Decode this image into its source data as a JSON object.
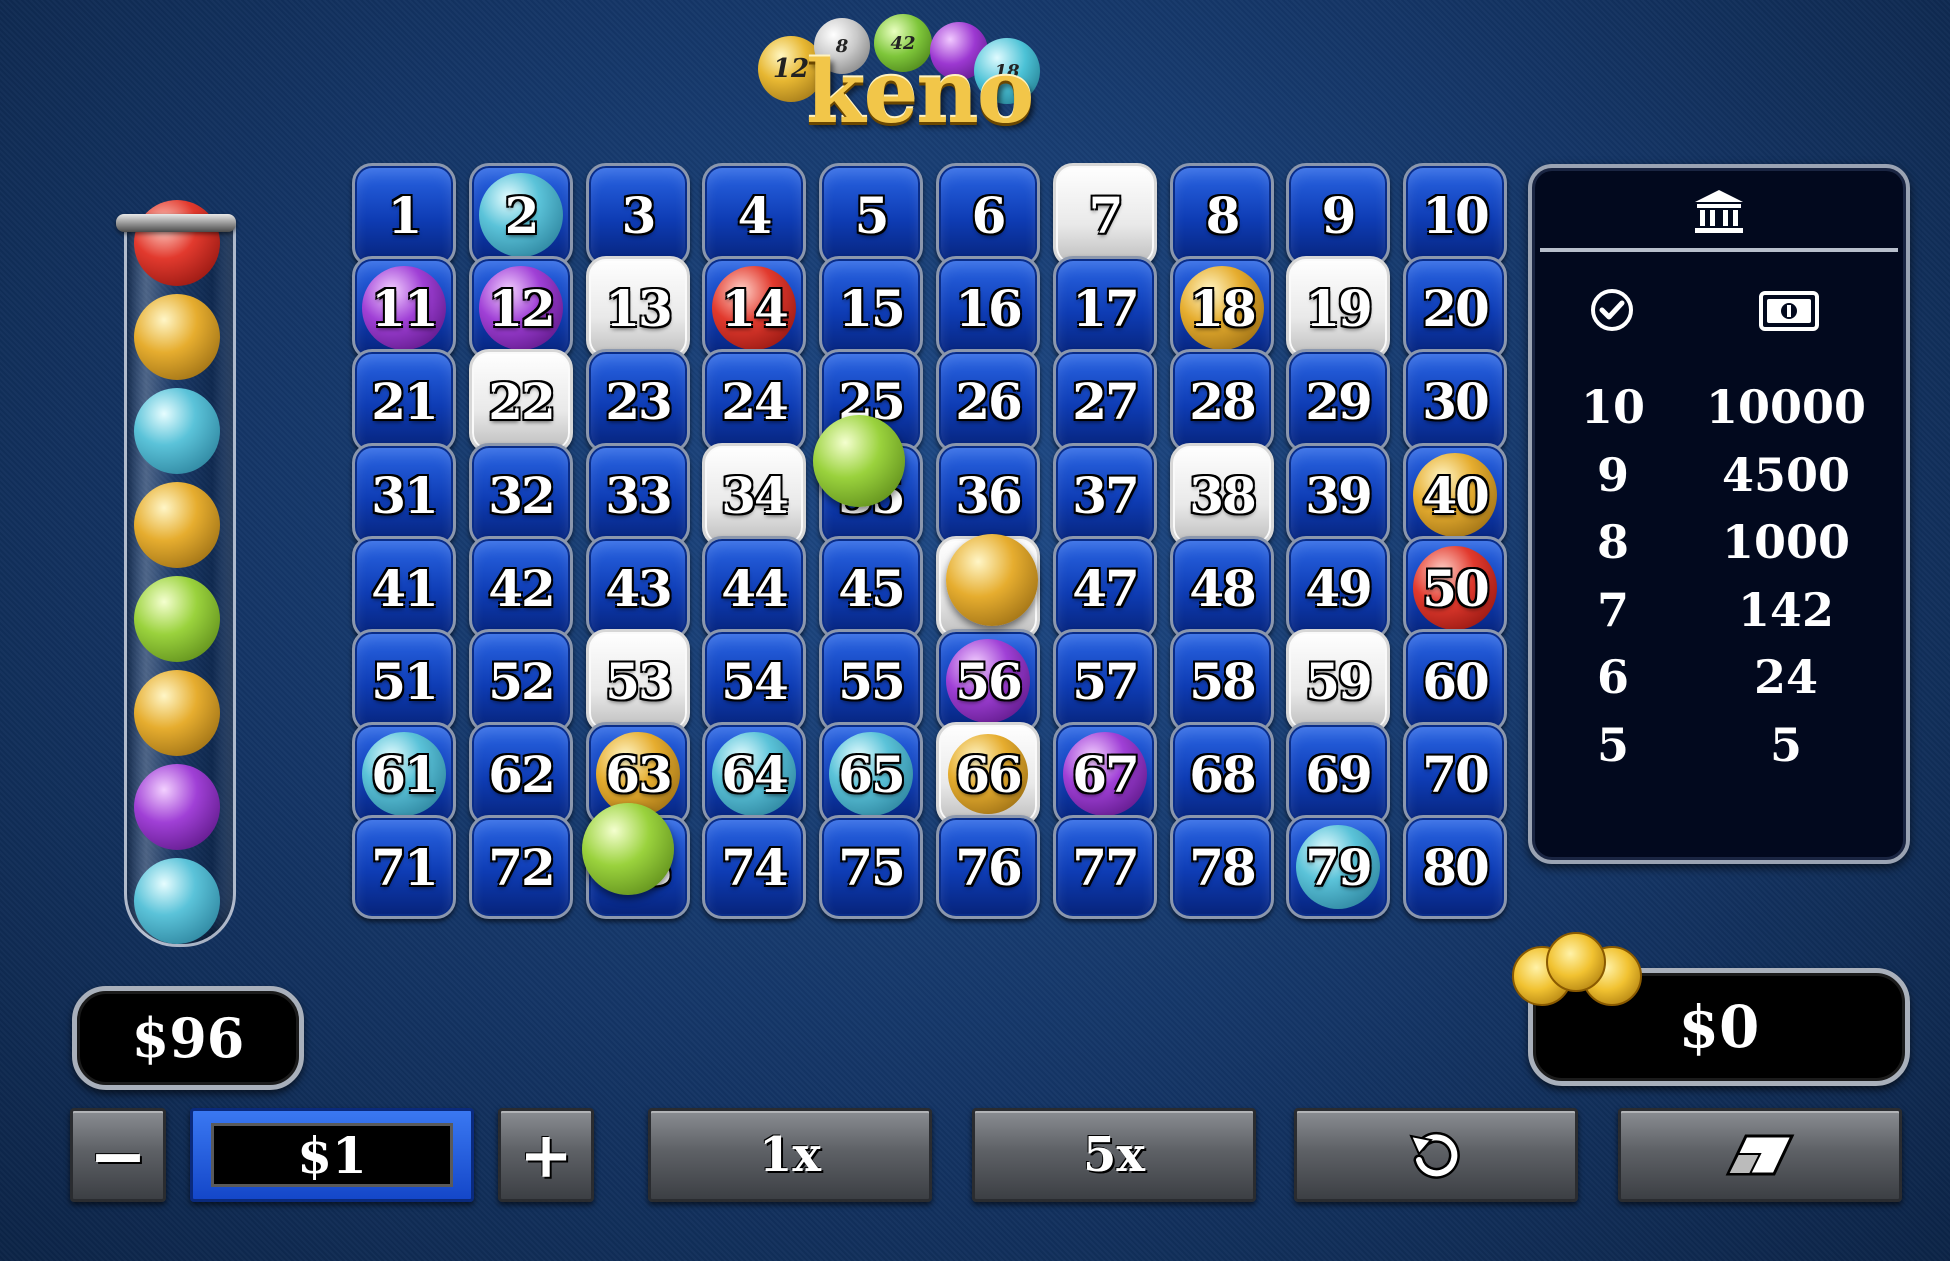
{
  "logo": {
    "word": "keno",
    "ball_numbers": [
      "12",
      "8",
      "42",
      "",
      "18"
    ]
  },
  "balance": "$96",
  "win": "$0",
  "bet": {
    "minus_label": "−",
    "value": "$1",
    "plus_label": "+"
  },
  "buttons": {
    "play_1x": "1x",
    "play_5x": "5x",
    "undo_icon": "undo-icon",
    "clear_icon": "eraser-icon"
  },
  "paytable": {
    "header_icon": "bank-icon",
    "hits_icon": "check-circle-icon",
    "pays_icon": "banknote-icon",
    "rows": [
      {
        "hits": "10",
        "pays": "10000"
      },
      {
        "hits": "9",
        "pays": "4500"
      },
      {
        "hits": "8",
        "pays": "1000"
      },
      {
        "hits": "7",
        "pays": "142"
      },
      {
        "hits": "6",
        "pays": "24"
      },
      {
        "hits": "5",
        "pays": "5"
      }
    ]
  },
  "tube_balls": [
    "red",
    "gold",
    "blue",
    "gold",
    "green",
    "gold",
    "purple",
    "blue"
  ],
  "grid": {
    "numbers": [
      "1",
      "2",
      "3",
      "4",
      "5",
      "6",
      "7",
      "8",
      "9",
      "10",
      "11",
      "12",
      "13",
      "14",
      "15",
      "16",
      "17",
      "18",
      "19",
      "20",
      "21",
      "22",
      "23",
      "24",
      "25",
      "26",
      "27",
      "28",
      "29",
      "30",
      "31",
      "32",
      "33",
      "34",
      "35",
      "36",
      "37",
      "38",
      "39",
      "40",
      "41",
      "42",
      "43",
      "44",
      "45",
      "46",
      "47",
      "48",
      "49",
      "50",
      "51",
      "52",
      "53",
      "54",
      "55",
      "56",
      "57",
      "58",
      "59",
      "60",
      "61",
      "62",
      "63",
      "64",
      "65",
      "66",
      "67",
      "68",
      "69",
      "70",
      "71",
      "72",
      "73",
      "74",
      "75",
      "76",
      "77",
      "78",
      "79",
      "80"
    ],
    "selected": [
      "7",
      "13",
      "19",
      "22",
      "34",
      "38",
      "46",
      "53",
      "59",
      "66"
    ],
    "drawn": {
      "2": "blue",
      "11": "purple",
      "12": "purple",
      "14": "red",
      "18": "gold",
      "40": "gold",
      "50": "red",
      "56": "purple",
      "61": "blue",
      "63": "gold",
      "64": "blue",
      "65": "blue",
      "66": "gold",
      "67": "purple",
      "79": "blue"
    },
    "falling_balls": [
      {
        "color": "green",
        "over": "35"
      },
      {
        "color": "gold",
        "over": "46"
      },
      {
        "color": "green",
        "over": "73"
      }
    ]
  },
  "colors": {
    "cell_blue": "#0e3cb4",
    "cell_selected": "#ffffff",
    "gold": "#e6ad2f",
    "background": "#143566"
  }
}
